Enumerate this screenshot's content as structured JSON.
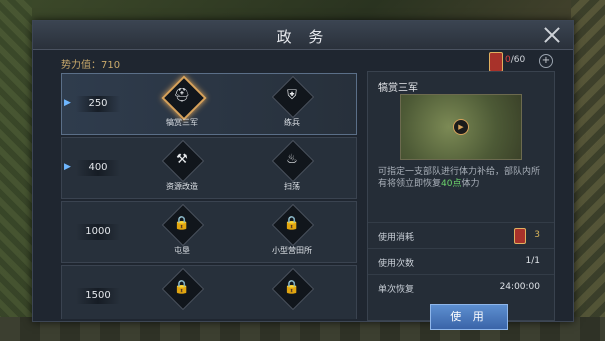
{
  "window": {
    "title": "政 务"
  },
  "header": {
    "power_label": "势力值：",
    "power_value": "710",
    "token_current": "0",
    "token_max": "/60",
    "plus_label": "+"
  },
  "rows": [
    {
      "level": "250",
      "items": [
        {
          "label": "犒赏三军",
          "icon": "helmet-icon",
          "glyph": "⛑"
        },
        {
          "label": "练兵",
          "icon": "shield-icon",
          "glyph": "⛨"
        }
      ]
    },
    {
      "level": "400",
      "items": [
        {
          "label": "资源改造",
          "icon": "anvil-icon",
          "glyph": "⚒"
        },
        {
          "label": "扫荡",
          "icon": "flame-icon",
          "glyph": "♨"
        }
      ]
    },
    {
      "level": "1000",
      "items": [
        {
          "label": "屯垦",
          "icon": "lock-icon",
          "glyph": "🔒"
        },
        {
          "label": "小型营田所",
          "icon": "lock-icon",
          "glyph": "🔒"
        }
      ]
    },
    {
      "level": "1500",
      "items": [
        {
          "label": "",
          "icon": "lock-icon",
          "glyph": "🔒"
        },
        {
          "label": "",
          "icon": "lock-icon",
          "glyph": "🔒"
        }
      ]
    }
  ],
  "detail": {
    "title": "犒赏三军",
    "desc_prefix": "可指定一支部队进行体力补给，部队内所有将领立即恢复",
    "desc_highlight": "40点",
    "desc_suffix": "体力",
    "stats": [
      {
        "label": "使用消耗",
        "value": "3"
      },
      {
        "label": "使用次数",
        "value": "1/1"
      },
      {
        "label": "单次恢复",
        "value": "24:00:00"
      }
    ],
    "use_label": "使 用"
  }
}
